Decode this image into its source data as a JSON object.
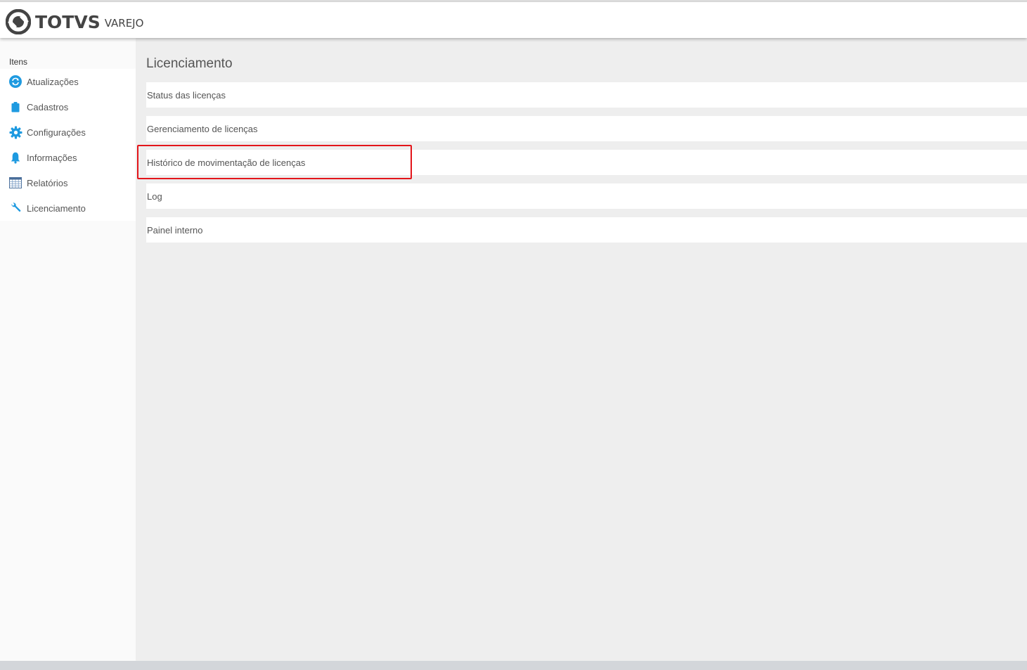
{
  "app": {
    "brand": "TOTVS",
    "product": "VAREJO",
    "icon": "totvs-logo"
  },
  "sidebar": {
    "heading": "Itens",
    "items": [
      {
        "label": "Atualizações",
        "icon": "refresh-icon"
      },
      {
        "label": "Cadastros",
        "icon": "clipboard-icon"
      },
      {
        "label": "Configurações",
        "icon": "gear-icon"
      },
      {
        "label": "Informações",
        "icon": "bell-icon"
      },
      {
        "label": "Relatórios",
        "icon": "table-icon"
      },
      {
        "label": "Licenciamento",
        "icon": "wrench-icon"
      }
    ]
  },
  "main": {
    "title": "Licenciamento",
    "items": [
      {
        "label": "Status das licenças"
      },
      {
        "label": "Gerenciamento de licenças"
      },
      {
        "label": "Histórico de movimentação de licenças",
        "highlighted": true
      },
      {
        "label": "Log"
      },
      {
        "label": "Painel interno"
      }
    ]
  },
  "colors": {
    "accent": "#1e9ae0",
    "highlight": "#e3151a",
    "brand": "#444444"
  }
}
